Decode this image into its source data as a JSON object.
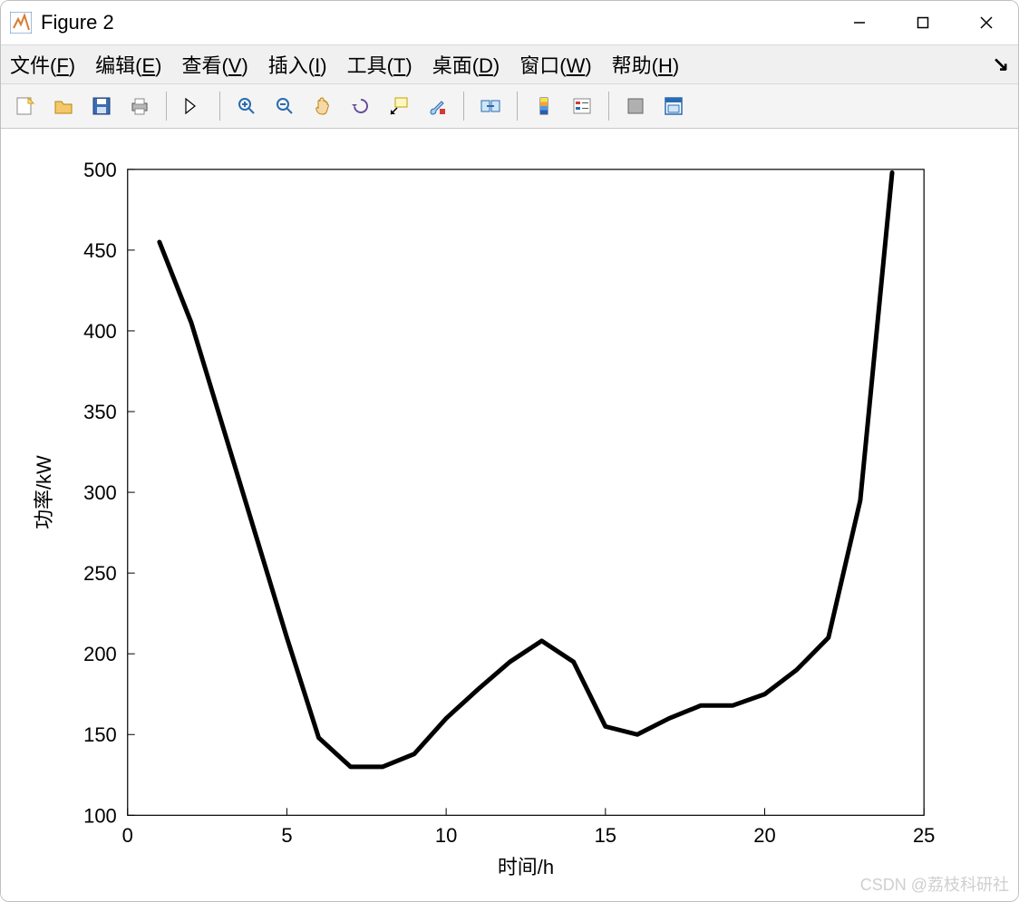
{
  "window": {
    "title": "Figure 2"
  },
  "menu": {
    "file": {
      "label": "文件(",
      "key": "F",
      "tail": ")"
    },
    "edit": {
      "label": "编辑(",
      "key": "E",
      "tail": ")"
    },
    "view": {
      "label": "查看(",
      "key": "V",
      "tail": ")"
    },
    "insert": {
      "label": "插入(",
      "key": "I",
      "tail": ")"
    },
    "tools": {
      "label": "工具(",
      "key": "T",
      "tail": ")"
    },
    "desktop": {
      "label": "桌面(",
      "key": "D",
      "tail": ")"
    },
    "windowm": {
      "label": "窗口(",
      "key": "W",
      "tail": ")"
    },
    "help": {
      "label": "帮助(",
      "key": "H",
      "tail": ")"
    }
  },
  "toolbar_icons": {
    "new": "new-icon",
    "open": "open-icon",
    "save": "save-icon",
    "print": "print-icon",
    "pointer": "pointer-icon",
    "zoomin": "zoom-in-icon",
    "zoomout": "zoom-out-icon",
    "pan": "pan-icon",
    "rotate": "rotate-icon",
    "datatip": "data-cursor-icon",
    "brush": "brush-icon",
    "link": "link-icon",
    "colorbar": "colorbar-icon",
    "legend": "legend-icon",
    "hide": "hide-icon",
    "dock": "dock-icon"
  },
  "watermark": "CSDN @荔枝科研社",
  "chart_data": {
    "type": "line",
    "title": "",
    "xlabel": "时间/h",
    "ylabel": "功率/kW",
    "xlim": [
      0,
      25
    ],
    "ylim": [
      100,
      500
    ],
    "xticks": [
      0,
      5,
      10,
      15,
      20,
      25
    ],
    "yticks": [
      100,
      150,
      200,
      250,
      300,
      350,
      400,
      450,
      500
    ],
    "x": [
      1,
      2,
      3,
      4,
      5,
      6,
      7,
      8,
      9,
      10,
      11,
      12,
      13,
      14,
      15,
      16,
      17,
      18,
      19,
      20,
      21,
      22,
      23,
      24
    ],
    "values": [
      455,
      405,
      340,
      275,
      210,
      148,
      130,
      130,
      138,
      160,
      178,
      195,
      208,
      195,
      155,
      150,
      160,
      168,
      168,
      175,
      190,
      210,
      295,
      498
    ]
  }
}
